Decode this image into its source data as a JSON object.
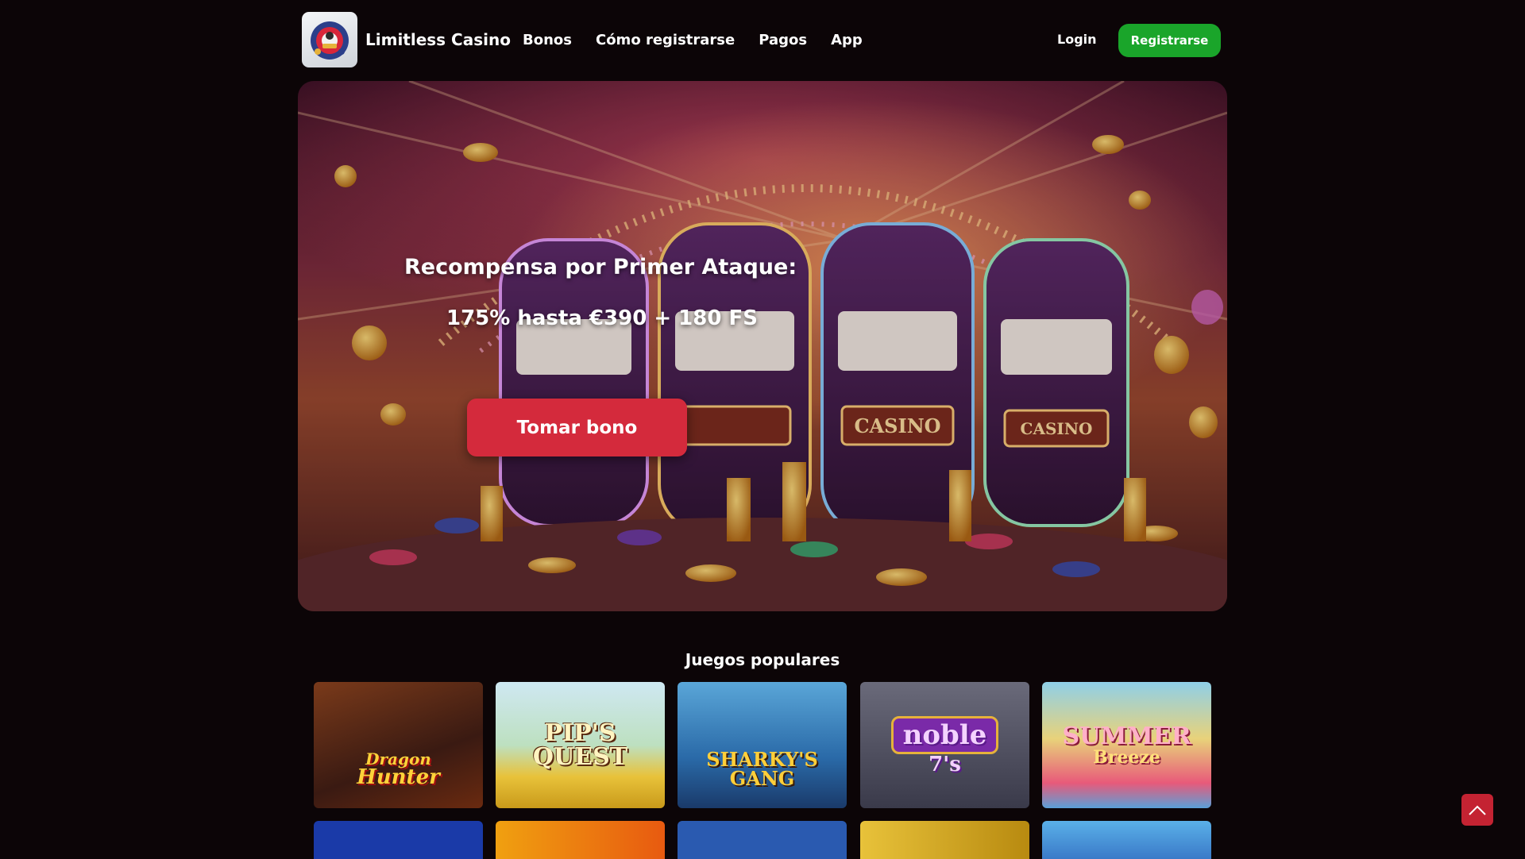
{
  "header": {
    "brand": "Limitless Casino",
    "nav": [
      "Bonos",
      "Cómo registrarse",
      "Pagos",
      "App"
    ],
    "login_label": "Login",
    "register_label": "Registrarse"
  },
  "hero": {
    "title": "Recompensa por Primer Ataque:",
    "subtitle": "175% hasta €390 + 180 FS",
    "cta_label": "Tomar bono",
    "background_text": "CASINO"
  },
  "games": {
    "title": "Juegos populares",
    "row1": [
      {
        "name": "Dragon Hunter",
        "line1": "Dragon",
        "line2": "Hunter"
      },
      {
        "name": "Pip's Quest",
        "line1": "PIP'S",
        "line2": "QUEST"
      },
      {
        "name": "Sharky's Gang",
        "line1": "SHARKY'S",
        "line2": "GANG"
      },
      {
        "name": "Noble 7's",
        "line1": "noble",
        "line2": "7's"
      },
      {
        "name": "Summer Breeze",
        "line1": "SUMMER",
        "line2": "Breeze"
      }
    ]
  },
  "colors": {
    "background": "#0c0507",
    "register": "#1aa52a",
    "cta": "#d42a3c",
    "scroll_top": "#c42332"
  }
}
